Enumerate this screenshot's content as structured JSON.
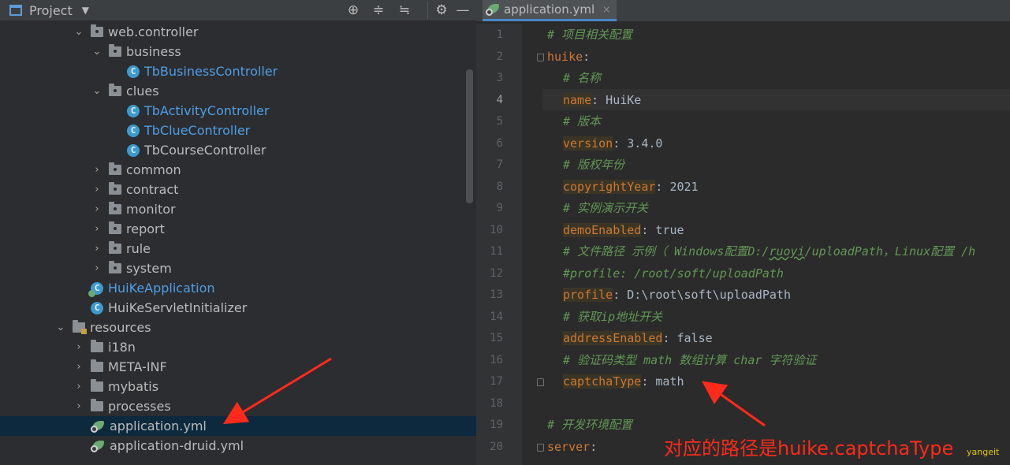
{
  "project_panel": {
    "title": "Project",
    "toolbar_icons": [
      "locate-icon",
      "expand-all-icon",
      "collapse-all-icon",
      "gear-icon",
      "minimize-icon"
    ],
    "tree": [
      {
        "label": "web.controller",
        "kind": "package",
        "indent": 2,
        "arrow": "down"
      },
      {
        "label": "business",
        "kind": "package",
        "indent": 3,
        "arrow": "down"
      },
      {
        "label": "TbBusinessController",
        "kind": "class",
        "indent": 4,
        "arrow": "none"
      },
      {
        "label": "clues",
        "kind": "package",
        "indent": 3,
        "arrow": "down"
      },
      {
        "label": "TbActivityController",
        "kind": "class",
        "indent": 4,
        "arrow": "none"
      },
      {
        "label": "TbClueController",
        "kind": "class",
        "indent": 4,
        "arrow": "none"
      },
      {
        "label": "TbCourseController",
        "kind": "class-plain",
        "indent": 4,
        "arrow": "none"
      },
      {
        "label": "common",
        "kind": "package",
        "indent": 3,
        "arrow": "right"
      },
      {
        "label": "contract",
        "kind": "package",
        "indent": 3,
        "arrow": "right"
      },
      {
        "label": "monitor",
        "kind": "package",
        "indent": 3,
        "arrow": "right"
      },
      {
        "label": "report",
        "kind": "package",
        "indent": 3,
        "arrow": "right"
      },
      {
        "label": "rule",
        "kind": "package",
        "indent": 3,
        "arrow": "right"
      },
      {
        "label": "system",
        "kind": "package",
        "indent": 3,
        "arrow": "right"
      },
      {
        "label": "HuiKeApplication",
        "kind": "app-class",
        "indent": 2,
        "arrow": "none"
      },
      {
        "label": "HuiKeServletInitializer",
        "kind": "class-plain",
        "indent": 2,
        "arrow": "none"
      },
      {
        "label": "resources",
        "kind": "resources",
        "indent": 1,
        "arrow": "down"
      },
      {
        "label": "i18n",
        "kind": "folder",
        "indent": 2,
        "arrow": "right"
      },
      {
        "label": "META-INF",
        "kind": "folder",
        "indent": 2,
        "arrow": "right"
      },
      {
        "label": "mybatis",
        "kind": "folder",
        "indent": 2,
        "arrow": "right"
      },
      {
        "label": "processes",
        "kind": "folder",
        "indent": 2,
        "arrow": "right"
      },
      {
        "label": "application.yml",
        "kind": "yml",
        "indent": 2,
        "arrow": "none",
        "selected": true
      },
      {
        "label": "application-druid.yml",
        "kind": "yml",
        "indent": 2,
        "arrow": "none"
      }
    ]
  },
  "editor": {
    "tab_label": "application.yml",
    "tab_close": "×",
    "current_line": 4,
    "lines": [
      {
        "n": "1",
        "segs": [
          [
            "cm",
            "# 项目相关配置"
          ]
        ],
        "indent": 0
      },
      {
        "n": "2",
        "segs": [
          [
            "key",
            "huike"
          ],
          [
            "p",
            ":"
          ]
        ],
        "indent": 0,
        "fold": true
      },
      {
        "n": "3",
        "segs": [
          [
            "cm",
            "# 名称"
          ]
        ],
        "indent": 1
      },
      {
        "n": "4",
        "segs": [
          [
            "keyhl",
            "name"
          ],
          [
            "p",
            ": HuiKe"
          ]
        ],
        "indent": 1
      },
      {
        "n": "5",
        "segs": [
          [
            "cm",
            "# 版本"
          ]
        ],
        "indent": 1
      },
      {
        "n": "6",
        "segs": [
          [
            "keyhl",
            "version"
          ],
          [
            "p",
            ": 3.4.0"
          ]
        ],
        "indent": 1
      },
      {
        "n": "7",
        "segs": [
          [
            "cm",
            "# 版权年份"
          ]
        ],
        "indent": 1
      },
      {
        "n": "8",
        "segs": [
          [
            "keyhl",
            "copyrightYear"
          ],
          [
            "p",
            ": 2021"
          ]
        ],
        "indent": 1
      },
      {
        "n": "9",
        "segs": [
          [
            "cm",
            "# 实例演示开关"
          ]
        ],
        "indent": 1
      },
      {
        "n": "10",
        "segs": [
          [
            "keyhl",
            "demoEnabled"
          ],
          [
            "p",
            ": true"
          ]
        ],
        "indent": 1
      },
      {
        "n": "11",
        "segs": [
          [
            "cm",
            "# 文件路径 示例（ Windows配置D:/"
          ],
          [
            "cmsq",
            "ruoyi"
          ],
          [
            "cm",
            "/uploadPath，Linux配置 /h"
          ]
        ],
        "indent": 1
      },
      {
        "n": "12",
        "segs": [
          [
            "cm",
            "#profile: /root/soft/uploadPath"
          ]
        ],
        "indent": 1
      },
      {
        "n": "13",
        "segs": [
          [
            "keyhl",
            "profile"
          ],
          [
            "p",
            ": D:\\root\\soft\\uploadPath"
          ]
        ],
        "indent": 1
      },
      {
        "n": "14",
        "segs": [
          [
            "cm",
            "# 获取ip地址开关"
          ]
        ],
        "indent": 1
      },
      {
        "n": "15",
        "segs": [
          [
            "keyhl",
            "addressEnabled"
          ],
          [
            "p",
            ": false"
          ]
        ],
        "indent": 1
      },
      {
        "n": "16",
        "segs": [
          [
            "cm",
            "# 验证码类型 math 数组计算 char 字符验证"
          ]
        ],
        "indent": 1
      },
      {
        "n": "17",
        "segs": [
          [
            "keyhl",
            "captchaType"
          ],
          [
            "p",
            ": math"
          ]
        ],
        "indent": 1,
        "foldend": true
      },
      {
        "n": "18",
        "segs": [],
        "indent": 0
      },
      {
        "n": "19",
        "segs": [
          [
            "cm",
            "# 开发环境配置"
          ]
        ],
        "indent": 0
      },
      {
        "n": "20",
        "segs": [
          [
            "key",
            "server"
          ],
          [
            "p",
            ":"
          ]
        ],
        "indent": 0,
        "fold": true
      }
    ]
  },
  "annotation": {
    "text": "对应的路径是huike.captchaType",
    "color": "#ff2a1a"
  },
  "watermark": "yangeit"
}
